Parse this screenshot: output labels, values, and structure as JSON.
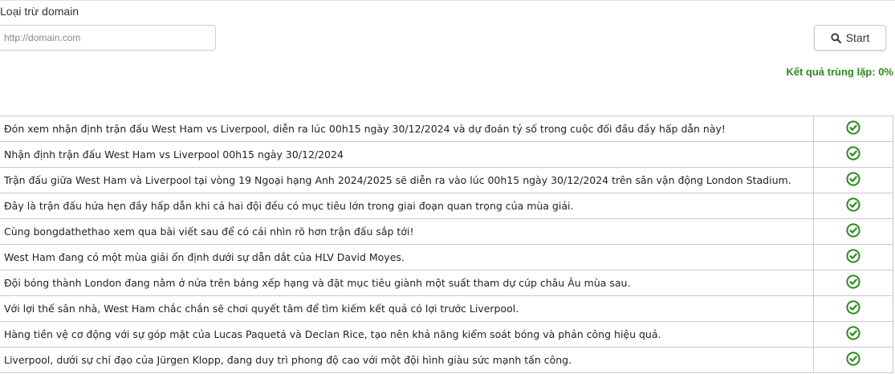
{
  "exclude": {
    "label": "Loại trừ domain",
    "placeholder": "http://domain.com"
  },
  "start_button": {
    "label": "Start",
    "icon": "search-icon"
  },
  "result": {
    "label": "Kết quả trùng lặp:",
    "value": "0%"
  },
  "colors": {
    "accent_green": "#2e8b1e",
    "border": "#c9c9c9"
  },
  "rows": [
    {
      "text": "Đón xem nhận định trận đấu West Ham vs Liverpool, diễn ra lúc 00h15 ngày 30/12/2024 và dự đoán tỷ số trong cuộc đối đầu đầy hấp dẫn này!",
      "status": "check-circle-icon"
    },
    {
      "text": "Nhận định trận đấu West Ham vs Liverpool 00h15 ngày 30/12/2024",
      "status": "check-circle-icon"
    },
    {
      "text": "Trận đấu giữa West Ham và Liverpool tại vòng 19 Ngoại hạng Anh 2024/2025 sẽ diễn ra vào lúc 00h15 ngày 30/12/2024 trên sân vận động London Stadium.",
      "status": "check-circle-icon"
    },
    {
      "text": "Đây là trận đấu hứa hẹn đầy hấp dẫn khi cả hai đội đều có mục tiêu lớn trong giai đoạn quan trọng của mùa giải.",
      "status": "check-circle-icon"
    },
    {
      "text": "Cùng bongdathethao xem qua bài viết sau để có cái nhìn rõ hơn trận đấu sắp tới!",
      "status": "check-circle-icon"
    },
    {
      "text": "West Ham đang có một mùa giải ổn định dưới sự dẫn dắt của HLV David Moyes.",
      "status": "check-circle-icon"
    },
    {
      "text": "Đội bóng thành London đang nằm ở nửa trên bảng xếp hạng và đặt mục tiêu giành một suất tham dự cúp châu Âu mùa sau.",
      "status": "check-circle-icon"
    },
    {
      "text": "Với lợi thế sân nhà, West Ham chắc chắn sẽ chơi quyết tâm để tìm kiếm kết quả có lợi trước Liverpool.",
      "status": "check-circle-icon"
    },
    {
      "text": "Hàng tiền vệ cơ động với sự góp mặt của Lucas Paquetá và Declan Rice, tạo nên khả năng kiểm soát bóng và phản công hiệu quả.",
      "status": "check-circle-icon"
    },
    {
      "text": "Liverpool, dưới sự chỉ đạo của Jürgen Klopp, đang duy trì phong độ cao với một đội hình giàu sức mạnh tấn công.",
      "status": "check-circle-icon"
    }
  ]
}
